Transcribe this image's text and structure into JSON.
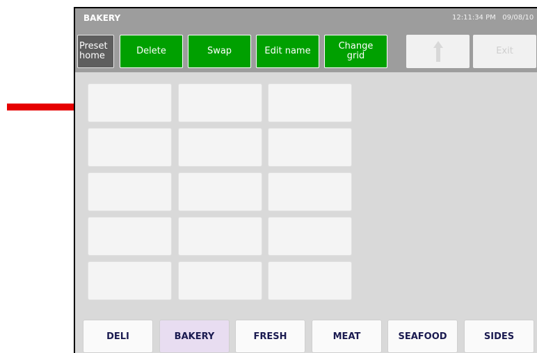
{
  "window": {
    "title": "BAKERY",
    "time": "12:11:34 PM",
    "date": "09/08/10"
  },
  "toolbar": {
    "preset_home": "Preset\nhome",
    "delete": "Delete",
    "swap": "Swap",
    "edit_name": "Edit name",
    "change_grid": "Change\ngrid",
    "up_icon": "up-arrow-icon",
    "exit": "Exit"
  },
  "grid": {
    "rows": 5,
    "columns": 3,
    "cells": [
      "",
      "",
      "",
      "",
      "",
      "",
      "",
      "",
      "",
      "",
      "",
      "",
      "",
      "",
      ""
    ]
  },
  "tabs": [
    {
      "label": "DELI",
      "active": false
    },
    {
      "label": "BAKERY",
      "active": true
    },
    {
      "label": "FRESH",
      "active": false
    },
    {
      "label": "MEAT",
      "active": false
    },
    {
      "label": "SEAFOOD",
      "active": false
    },
    {
      "label": "SIDES",
      "active": false
    }
  ],
  "annotation": {
    "arrow_color": "#e60000"
  },
  "colors": {
    "toolbar_bg": "#9d9d9d",
    "action_green": "#00a000",
    "active_tab": "#e8ddf1"
  }
}
